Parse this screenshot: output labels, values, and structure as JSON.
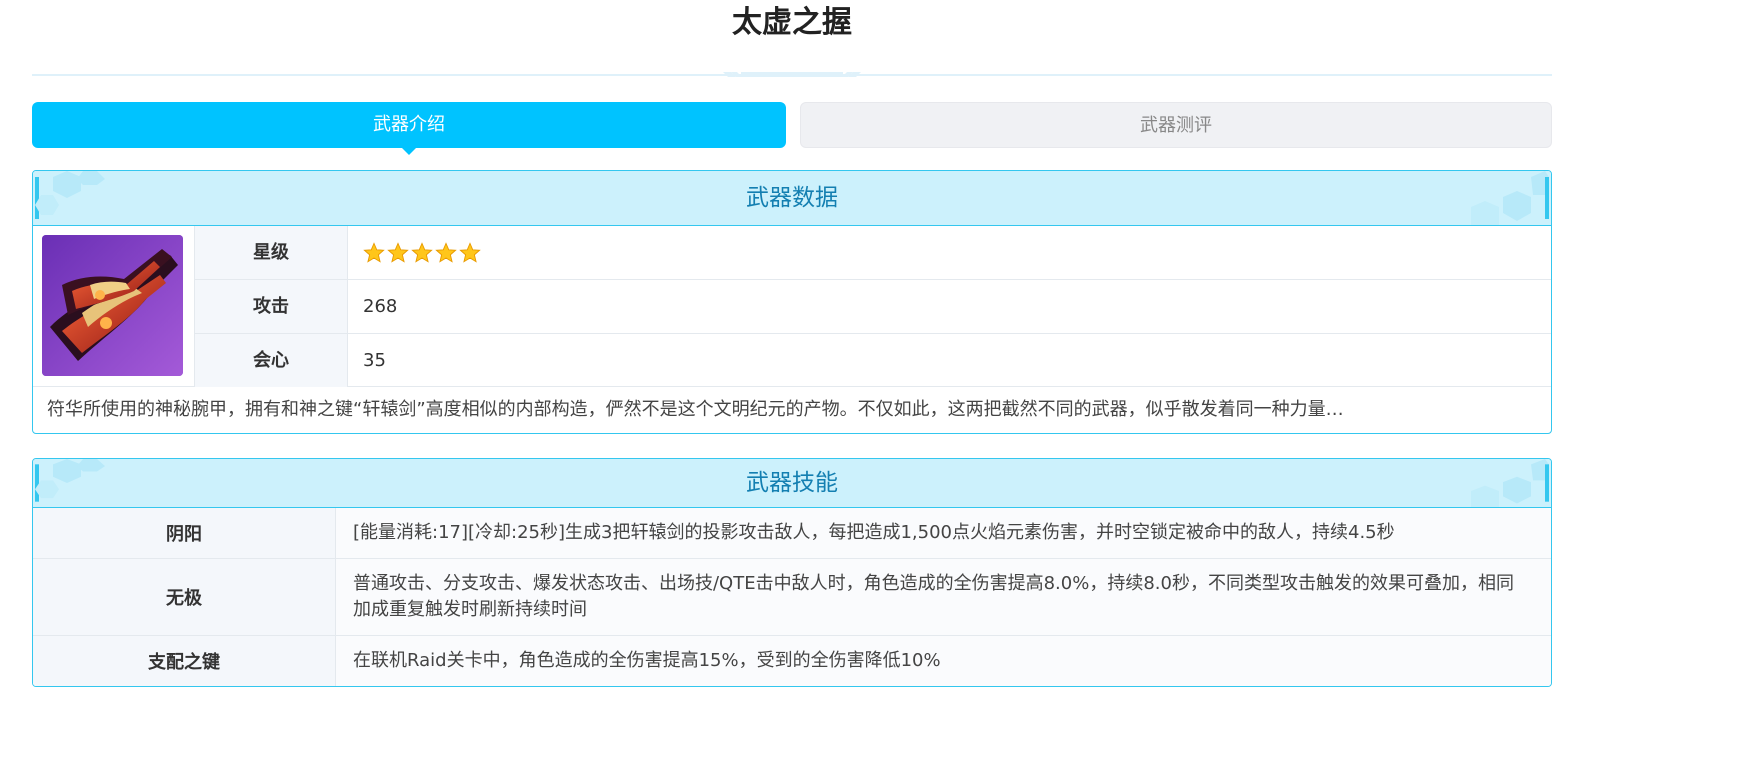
{
  "page": {
    "title": "太虚之握"
  },
  "tabs": [
    {
      "label": "武器介绍",
      "active": true
    },
    {
      "label": "武器测评",
      "active": false
    }
  ],
  "weapon_data": {
    "section_title": "武器数据",
    "image_icon": "gauntlet-weapon-icon",
    "rows": [
      {
        "label": "星级",
        "stars": 5
      },
      {
        "label": "攻击",
        "value": "268"
      },
      {
        "label": "会心",
        "value": "35"
      }
    ],
    "description": "符华所使用的神秘腕甲，拥有和神之键“轩辕剑”高度相似的内部构造，俨然不是这个文明纪元的产物。不仅如此，这两把截然不同的武器，似乎散发着同一种力量…"
  },
  "weapon_skills": {
    "section_title": "武器技能",
    "rows": [
      {
        "label": "阴阳",
        "value": "[能量消耗:17][冷却:25秒]生成3把轩辕剑的投影攻击敌人，每把造成1,500点火焰元素伤害，并时空锁定被命中的敌人，持续4.5秒"
      },
      {
        "label": "无极",
        "value": "普通攻击、分支攻击、爆发状态攻击、出场技/QTE击中敌人时，角色造成的全伤害提高8.0%，持续8.0秒，不同类型攻击触发的效果可叠加，相同加成重复触发时刷新持续时间"
      },
      {
        "label": "支配之键",
        "value": "在联机Raid关卡中，角色造成的全伤害提高15%，受到的全伤害降低10%"
      }
    ]
  },
  "colors": {
    "accent": "#00c3ff",
    "panel_header_bg": "#ccf1fc",
    "panel_header_text": "#137fb1",
    "panel_border": "#34c7ef",
    "star": "#ffc61a"
  }
}
